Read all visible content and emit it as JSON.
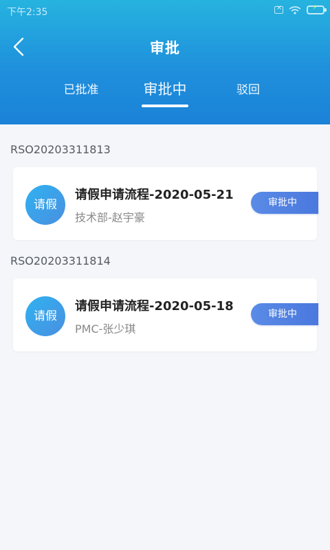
{
  "status_bar": {
    "time": "下午2:35"
  },
  "header": {
    "title": "审批",
    "back_icon": "chevron-left-icon"
  },
  "tabs": [
    {
      "label": "已批准",
      "active": false
    },
    {
      "label": "审批中",
      "active": true
    },
    {
      "label": "驳回",
      "active": false
    }
  ],
  "items": [
    {
      "order_no": "RSO20203311813",
      "avatar_text": "请假",
      "title": "请假申请流程-2020-05-21",
      "subtitle": "技术部-赵宇豪",
      "status": "审批中"
    },
    {
      "order_no": "RSO20203311814",
      "avatar_text": "请假",
      "title": "请假申请流程-2020-05-18",
      "subtitle": "PMC-张少琪",
      "status": "审批中"
    }
  ],
  "colors": {
    "header_top": "#26b3df",
    "header_bottom": "#1b82d8",
    "status_button": "#4f82e2",
    "background": "#f4f6f9"
  }
}
